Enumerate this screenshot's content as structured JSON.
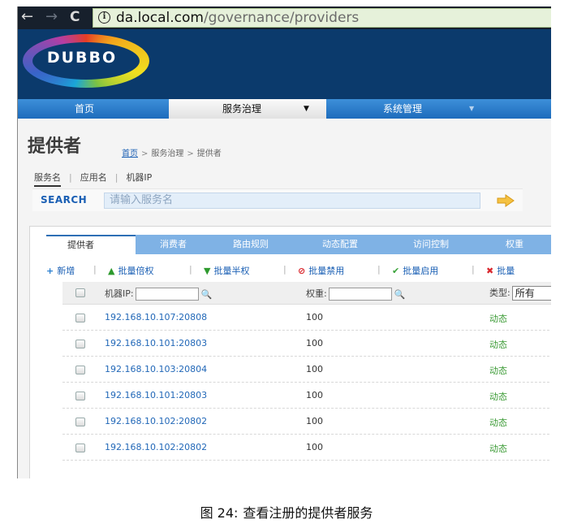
{
  "browser": {
    "back_glyph": "←",
    "forward_glyph": "→",
    "reload_glyph": "C",
    "info_glyph": "i",
    "url_host": "da.local.com",
    "url_path": "/governance/providers"
  },
  "header": {
    "logo_text": "DUBBO"
  },
  "nav": {
    "home": "首页",
    "service_governance": "服务治理",
    "service_caret": "▼",
    "system_management": "系统管理",
    "system_caret": "▼"
  },
  "page": {
    "title": "提供者",
    "breadcrumb": {
      "home": "首页",
      "separator": ">",
      "level2": "服务治理",
      "level3": "提供者"
    }
  },
  "filter_tabs": {
    "items": [
      "服务名",
      "应用名",
      "机器IP"
    ],
    "separator": "|"
  },
  "search": {
    "label": "SEARCH",
    "placeholder": "请输入服务名"
  },
  "tabs": [
    "提供者",
    "消费者",
    "路由规则",
    "动态配置",
    "访问控制",
    "权重"
  ],
  "toolbar": {
    "separator": "|",
    "add": "新增",
    "double": "批量倍权",
    "half": "批量半权",
    "disable": "批量禁用",
    "enable": "批量启用",
    "more": "批量",
    "icons": {
      "add": "+",
      "double": "▲",
      "half": "▼",
      "disable": "⊘",
      "enable": "✔",
      "more": "✖"
    }
  },
  "table": {
    "header": {
      "ip_label": "机器IP:",
      "weight_label": "权重:",
      "type_label": "类型:",
      "type_value": "所有",
      "search_glyph": "🔍"
    },
    "rows": [
      {
        "ip": "192.168.10.107:20808",
        "weight": "100",
        "type": "动态"
      },
      {
        "ip": "192.168.10.101:20803",
        "weight": "100",
        "type": "动态"
      },
      {
        "ip": "192.168.10.103:20804",
        "weight": "100",
        "type": "动态"
      },
      {
        "ip": "192.168.10.101:20803",
        "weight": "100",
        "type": "动态"
      },
      {
        "ip": "192.168.10.102:20802",
        "weight": "100",
        "type": "动态"
      },
      {
        "ip": "192.168.10.102:20802",
        "weight": "100",
        "type": "动态"
      }
    ]
  },
  "caption": {
    "number": "图 24:",
    "text": "查看注册的提供者服务"
  },
  "colors": {
    "header_bg": "#0b3a6c",
    "nav_bg": "#1d6cbc",
    "link": "#1a5fb4",
    "type_green": "#3a9a34",
    "tab_bar": "#7fb2e5"
  }
}
